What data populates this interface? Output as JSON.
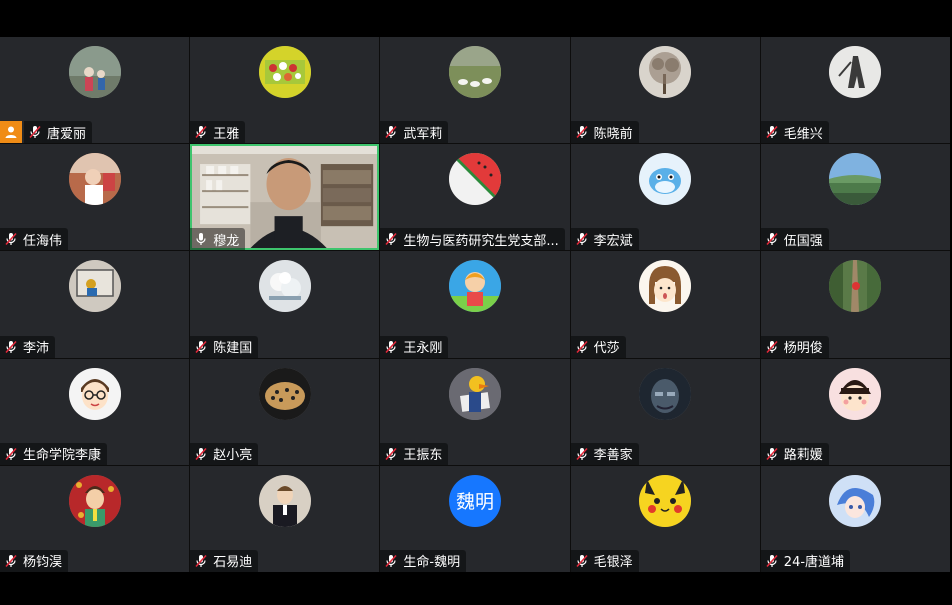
{
  "colors": {
    "tile_bg": "#26282c",
    "active_border": "#3ec46d",
    "host_badge": "#f08c16",
    "muted_mic": "#e0293a"
  },
  "participants": [
    {
      "name": "唐爱丽",
      "mic": "muted",
      "avatar": "photo-people-outdoor",
      "host": true
    },
    {
      "name": "王雅",
      "mic": "muted",
      "avatar": "photo-cakes"
    },
    {
      "name": "武军莉",
      "mic": "muted",
      "avatar": "photo-geese-field"
    },
    {
      "name": "陈晓前",
      "mic": "muted",
      "avatar": "photo-tree"
    },
    {
      "name": "毛维兴",
      "mic": "muted",
      "avatar": "photo-warrior-silhouette"
    },
    {
      "name": "任海伟",
      "mic": "muted",
      "avatar": "photo-child"
    },
    {
      "name": "穆龙",
      "mic": "on",
      "avatar": "video-feed",
      "speaking": true
    },
    {
      "name": "生物与医药研究生党支部...",
      "mic": "muted",
      "avatar": "watermelon"
    },
    {
      "name": "李宏斌",
      "mic": "muted",
      "avatar": "cartoon-dolphin"
    },
    {
      "name": "伍国强",
      "mic": "muted",
      "avatar": "photo-landscape"
    },
    {
      "name": "李沛",
      "mic": "muted",
      "avatar": "photo-room"
    },
    {
      "name": "陈建国",
      "mic": "muted",
      "avatar": "photo-flowers"
    },
    {
      "name": "王永刚",
      "mic": "muted",
      "avatar": "cartoon-kid"
    },
    {
      "name": "代莎",
      "mic": "muted",
      "avatar": "cartoon-girl"
    },
    {
      "name": "杨明俊",
      "mic": "muted",
      "avatar": "photo-trail"
    },
    {
      "name": "生命学院李康",
      "mic": "muted",
      "avatar": "cartoon-glasses-boy"
    },
    {
      "name": "赵小亮",
      "mic": "muted",
      "avatar": "photo-leopard"
    },
    {
      "name": "王振东",
      "mic": "muted",
      "avatar": "cartoon-duck-reading"
    },
    {
      "name": "李善家",
      "mic": "muted",
      "avatar": "photo-mosaic-face"
    },
    {
      "name": "路莉媛",
      "mic": "muted",
      "avatar": "cartoon-chibi"
    },
    {
      "name": "杨钧淏",
      "mic": "muted",
      "avatar": "cartoon-man-illustration"
    },
    {
      "name": "石易迪",
      "mic": "muted",
      "avatar": "photo-boy-suit"
    },
    {
      "name": "生命-魏明",
      "mic": "muted",
      "avatar": "text-avatar",
      "avatar_text": "魏明"
    },
    {
      "name": "毛银泽",
      "mic": "muted",
      "avatar": "pikachu"
    },
    {
      "name": "24-唐道埔",
      "mic": "muted",
      "avatar": "anime-blue-hair"
    }
  ]
}
